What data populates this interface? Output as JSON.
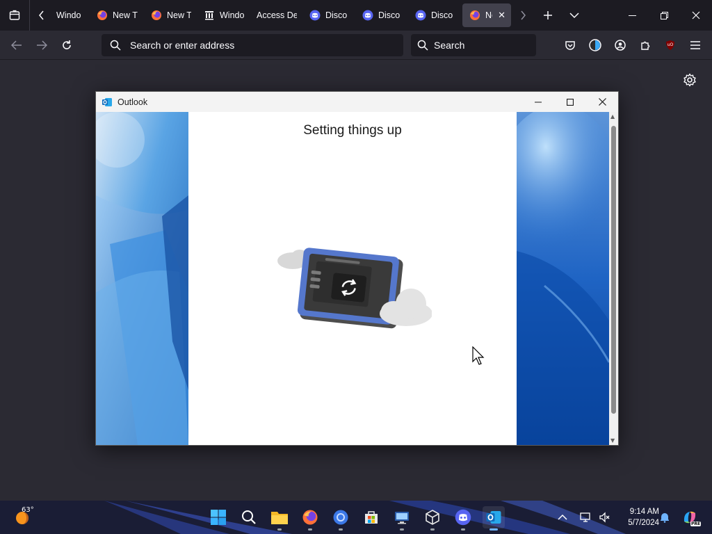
{
  "browser": {
    "tabs": [
      {
        "title": "Windo",
        "icon": "windows-icon"
      },
      {
        "title": "New T",
        "icon": "firefox-icon"
      },
      {
        "title": "New T",
        "icon": "firefox-icon"
      },
      {
        "title": "Windo",
        "icon": "library-icon"
      },
      {
        "title": "Access De",
        "icon": "none"
      },
      {
        "title": "Disco",
        "icon": "discord-icon"
      },
      {
        "title": "Disco",
        "icon": "discord-icon"
      },
      {
        "title": "Disco",
        "icon": "discord-icon"
      },
      {
        "title": "Ne",
        "icon": "firefox-icon",
        "active": true
      }
    ],
    "url_placeholder": "Search or enter address",
    "search_placeholder": "Search",
    "extension_badge": "uO"
  },
  "outlook": {
    "window_title": "Outlook",
    "heading": "Setting things up"
  },
  "taskbar": {
    "temperature": "63°",
    "time": "9:14 AM",
    "date": "5/7/2024",
    "copilot_badge": "PRE"
  },
  "colors": {
    "browser_bg": "#2b2a33",
    "tabstrip_bg": "#1c1b22",
    "discord": "#5865f2",
    "outlook_blue": "#0f6cbd"
  }
}
